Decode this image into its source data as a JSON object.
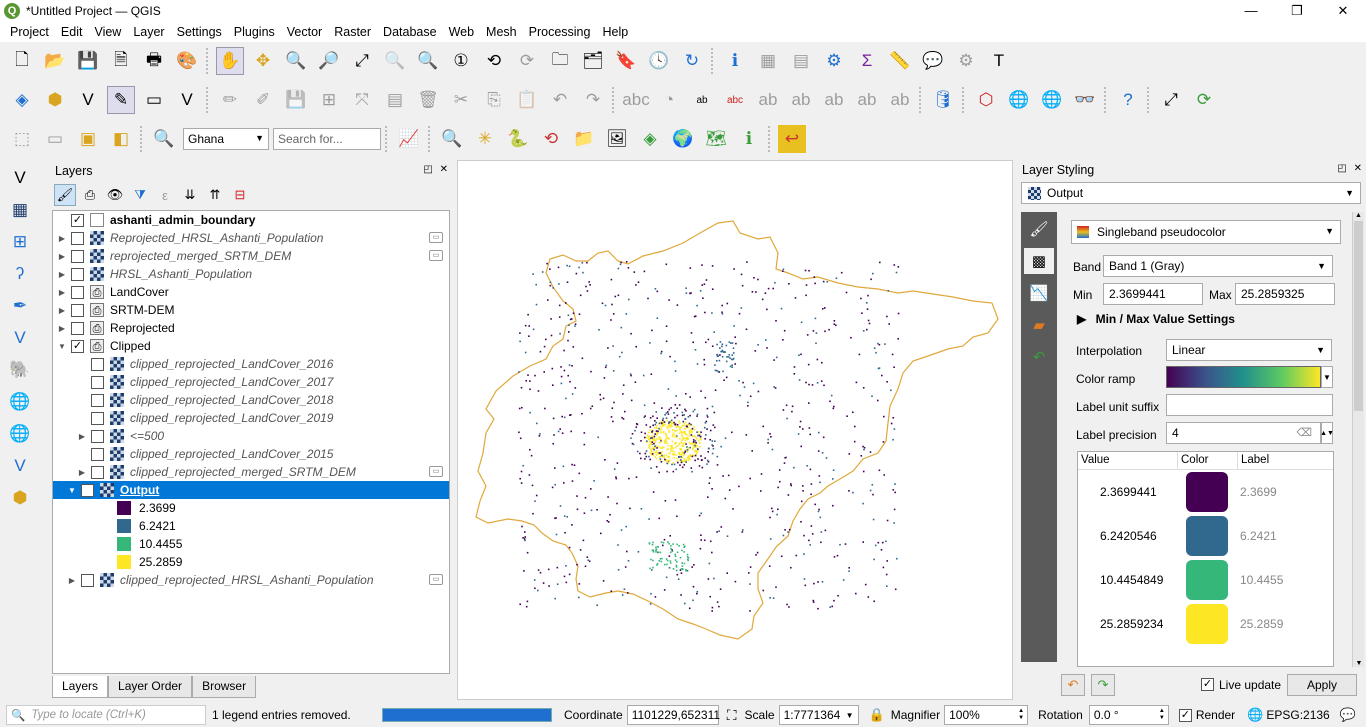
{
  "window": {
    "title": "*Untitled Project — QGIS",
    "logo": "Q",
    "controls": [
      "—",
      "❐",
      "✕"
    ]
  },
  "menu": [
    "Project",
    "Edit",
    "View",
    "Layer",
    "Settings",
    "Plugins",
    "Vector",
    "Raster",
    "Database",
    "Web",
    "Mesh",
    "Processing",
    "Help"
  ],
  "toolbar3": {
    "geocoder_value": "Ghana",
    "search_placeholder": "Search for..."
  },
  "layers_panel": {
    "title": "Layers",
    "header_buttons": "◰ ✕",
    "rows": [
      {
        "label": "ashanti_admin_boundary",
        "checked": true,
        "style": "bold",
        "type": "empty",
        "expander": "",
        "indent": 0,
        "embed": false
      },
      {
        "label": "Reprojected_HRSL_Ashanti_Population",
        "checked": false,
        "style": "italic",
        "type": "raster",
        "expander": "▶",
        "indent": 0,
        "embed": true
      },
      {
        "label": "reprojected_merged_SRTM_DEM",
        "checked": false,
        "style": "italic",
        "type": "raster",
        "expander": "▶",
        "indent": 0,
        "embed": true
      },
      {
        "label": "HRSL_Ashanti_Population",
        "checked": false,
        "style": "italic",
        "type": "raster",
        "expander": "▶",
        "indent": 0,
        "embed": false
      },
      {
        "label": "LandCover",
        "checked": false,
        "style": "normal",
        "type": "group",
        "expander": "▶",
        "indent": 0,
        "embed": false
      },
      {
        "label": "SRTM-DEM",
        "checked": false,
        "style": "normal",
        "type": "group",
        "expander": "▶",
        "indent": 0,
        "embed": false
      },
      {
        "label": "Reprojected",
        "checked": false,
        "style": "normal",
        "type": "group",
        "expander": "▶",
        "indent": 0,
        "embed": false
      },
      {
        "label": "Clipped",
        "checked": true,
        "style": "normal",
        "type": "group",
        "expander": "▼",
        "indent": 0,
        "embed": false
      },
      {
        "label": "clipped_reprojected_LandCover_2016",
        "checked": false,
        "style": "italic",
        "type": "raster",
        "expander": "",
        "indent": 1,
        "embed": false
      },
      {
        "label": "clipped_reprojected_LandCover_2017",
        "checked": false,
        "style": "italic",
        "type": "raster",
        "expander": "",
        "indent": 1,
        "embed": false
      },
      {
        "label": "clipped_reprojected_LandCover_2018",
        "checked": false,
        "style": "italic",
        "type": "raster",
        "expander": "",
        "indent": 1,
        "embed": false
      },
      {
        "label": "clipped_reprojected_LandCover_2019",
        "checked": false,
        "style": "italic",
        "type": "raster",
        "expander": "",
        "indent": 1,
        "embed": false
      },
      {
        "label": "<=500",
        "checked": false,
        "style": "italic",
        "type": "raster",
        "expander": "▶",
        "indent": 1,
        "embed": false
      },
      {
        "label": "clipped_reprojected_LandCover_2015",
        "checked": false,
        "style": "italic",
        "type": "raster",
        "expander": "",
        "indent": 1,
        "embed": false
      },
      {
        "label": "clipped_reprojected_merged_SRTM_DEM",
        "checked": false,
        "style": "italic",
        "type": "raster",
        "expander": "▶",
        "indent": 1,
        "embed": true
      }
    ],
    "selected": {
      "label": "Output",
      "checked": true,
      "expander": "▼"
    },
    "legend": [
      {
        "label": "2.3699",
        "color": "#440154"
      },
      {
        "label": "6.2421",
        "color": "#31688e"
      },
      {
        "label": "10.4455",
        "color": "#35b779"
      },
      {
        "label": "25.2859",
        "color": "#fde725"
      }
    ],
    "after": {
      "label": "clipped_reprojected_HRSL_Ashanti_Population",
      "checked": false,
      "expander": "▶"
    },
    "tabs": [
      "Layers",
      "Layer Order",
      "Browser"
    ]
  },
  "styling_panel": {
    "title": "Layer Styling",
    "header_buttons": "◰ ✕",
    "layer": "Output",
    "renderer": "Singleband pseudocolor",
    "band_label": "Band",
    "band": "Band 1 (Gray)",
    "min_label": "Min",
    "min": "2.3699441",
    "max_label": "Max",
    "max": "25.2859325",
    "minmax_settings": "Min / Max Value Settings",
    "interpolation_label": "Interpolation",
    "interpolation": "Linear",
    "color_ramp_label": "Color ramp",
    "unit_suffix_label": "Label unit suffix",
    "unit_suffix": "",
    "precision_label": "Label precision",
    "precision": "4",
    "table_headers": [
      "Value",
      "Color",
      "Label"
    ],
    "classes": [
      {
        "value": "2.3699441",
        "color": "#440154",
        "label": "2.3699"
      },
      {
        "value": "6.2420546",
        "color": "#31688e",
        "label": "6.2421"
      },
      {
        "value": "10.4454849",
        "color": "#35b779",
        "label": "10.4455"
      },
      {
        "value": "25.2859234",
        "color": "#fde725",
        "label": "25.2859"
      }
    ],
    "live_update_label": "Live update",
    "live_update": true,
    "apply_label": "Apply"
  },
  "statusbar": {
    "locate_placeholder": "Type to locate (Ctrl+K)",
    "message": "1 legend entries removed.",
    "coordinate_label": "Coordinate",
    "coordinate": "1101229,652311",
    "scale_label": "Scale",
    "scale": "1:7771364",
    "magnifier_label": "Magnifier",
    "magnifier": "100%",
    "rotation_label": "Rotation",
    "rotation": "0.0 °",
    "render_label": "Render",
    "render": true,
    "crs": "EPSG:2136"
  },
  "colors": {
    "selection": "#0078d7",
    "boundary": "#e0a83a"
  }
}
